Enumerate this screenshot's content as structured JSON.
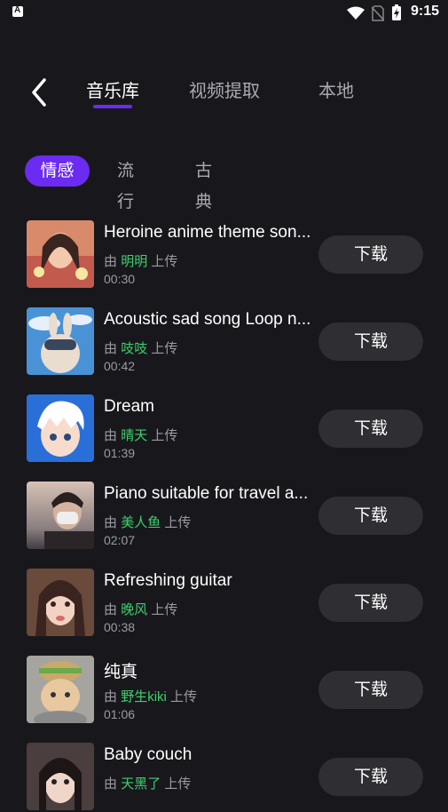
{
  "status_bar": {
    "time": "9:15"
  },
  "tabs": [
    "音乐库",
    "视频提取",
    "本地"
  ],
  "categories": [
    "情感",
    "流行",
    "古典"
  ],
  "songs": [
    {
      "title": "Heroine anime theme son...",
      "by": "由",
      "uploader": "明明",
      "upload_text": "上传",
      "duration": "00:30",
      "button": "下载"
    },
    {
      "title": "Acoustic sad song Loop n...",
      "by": "由",
      "uploader": "吱吱",
      "upload_text": "上传",
      "duration": "00:42",
      "button": "下载"
    },
    {
      "title": "Dream",
      "by": "由",
      "uploader": "晴天",
      "upload_text": "上传",
      "duration": "01:39",
      "button": "下载"
    },
    {
      "title": "Piano suitable for travel a...",
      "by": "由",
      "uploader": "美人鱼",
      "upload_text": "上传",
      "duration": "02:07",
      "button": "下载"
    },
    {
      "title": "Refreshing guitar",
      "by": "由",
      "uploader": "晚风",
      "upload_text": "上传",
      "duration": "00:38",
      "button": "下载"
    },
    {
      "title": "纯真",
      "by": "由",
      "uploader": "野生kiki",
      "upload_text": "上传",
      "duration": "01:06",
      "button": "下载"
    },
    {
      "title": "Baby couch",
      "by": "由",
      "uploader": "天黑了",
      "upload_text": "上传",
      "duration": "",
      "button": "下载"
    }
  ]
}
